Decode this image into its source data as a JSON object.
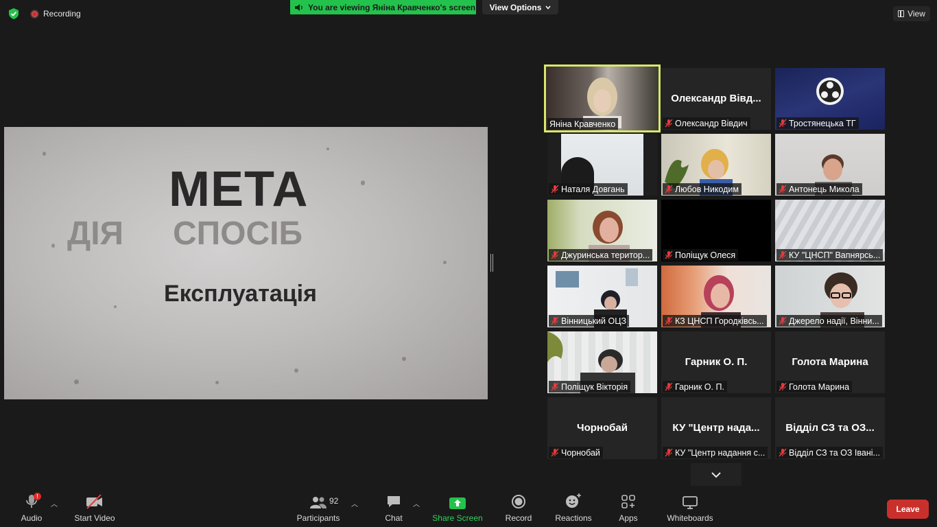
{
  "top_bar": {
    "recording_label": "Recording",
    "viewing_banner": "You are viewing Яніна Кравченко's screen",
    "view_options_label": "View Options",
    "view_label": "View"
  },
  "slide": {
    "title": "МЕТА",
    "word_left": "ДІЯ",
    "word_right": "СПОСІБ",
    "subtitle": "Експлуатація"
  },
  "participants": [
    {
      "label": "Яніна Кравченко",
      "display": "",
      "muted": false,
      "video": true,
      "active": true
    },
    {
      "label": "Олександр Вівдич",
      "display": "Олександр Вівд...",
      "muted": true,
      "video": false
    },
    {
      "label": "Тростянецька ТГ",
      "display": "",
      "muted": true,
      "video": true
    },
    {
      "label": "Наталя Довгань",
      "display": "",
      "muted": true,
      "video": true
    },
    {
      "label": "Любов Никодим",
      "display": "",
      "muted": true,
      "video": true
    },
    {
      "label": "Антонець Микола",
      "display": "",
      "muted": true,
      "video": true
    },
    {
      "label": "Джуринська територ...",
      "display": "",
      "muted": true,
      "video": true
    },
    {
      "label": "Поліщук Олеся",
      "display": "",
      "muted": true,
      "video": true
    },
    {
      "label": "КУ \"ЦНСП\" Вапнярсь...",
      "display": "",
      "muted": true,
      "video": true
    },
    {
      "label": "Вінницький ОЦЗ",
      "display": "",
      "muted": true,
      "video": true
    },
    {
      "label": "КЗ ЦНСП Городківсь...",
      "display": "",
      "muted": true,
      "video": true
    },
    {
      "label": "Джерело надії, Вінни...",
      "display": "",
      "muted": true,
      "video": true
    },
    {
      "label": "Поліщук Вікторія",
      "display": "",
      "muted": true,
      "video": true
    },
    {
      "label": "Гарник О. П.",
      "display": "Гарник О. П.",
      "muted": true,
      "video": false
    },
    {
      "label": "Голота Марина",
      "display": "Голота Марина",
      "muted": true,
      "video": false
    },
    {
      "label": "Чорнобай",
      "display": "Чорнобай",
      "muted": true,
      "video": false
    },
    {
      "label": "КУ \"Центр надання с...",
      "display": "КУ \"Центр нада...",
      "muted": true,
      "video": false
    },
    {
      "label": "Відділ СЗ та ОЗ Івані...",
      "display": "Відділ СЗ та ОЗ...",
      "muted": true,
      "video": false
    }
  ],
  "toolbar": {
    "audio": "Audio",
    "audio_alert": "!",
    "start_video": "Start Video",
    "participants": "Participants",
    "participants_count": "92",
    "chat": "Chat",
    "share_screen": "Share Screen",
    "record": "Record",
    "reactions": "Reactions",
    "apps": "Apps",
    "whiteboards": "Whiteboards",
    "leave": "Leave"
  },
  "colors": {
    "share_green": "#23c24c",
    "leave_red": "#c9302c",
    "active_speaker": "#d8e86a"
  }
}
